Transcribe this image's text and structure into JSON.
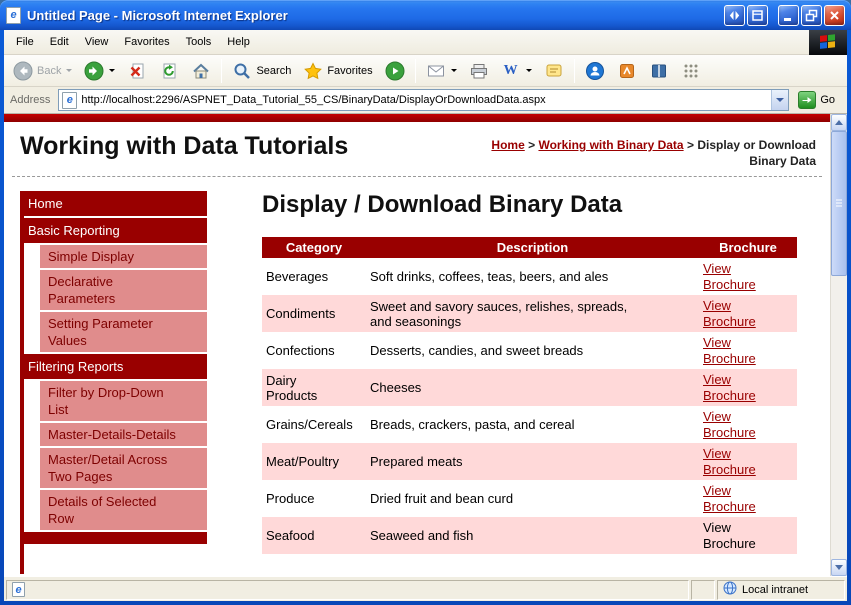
{
  "window": {
    "title": "Untitled Page - Microsoft Internet Explorer"
  },
  "menu": {
    "items": [
      {
        "label": "File"
      },
      {
        "label": "Edit"
      },
      {
        "label": "View"
      },
      {
        "label": "Favorites"
      },
      {
        "label": "Tools"
      },
      {
        "label": "Help"
      }
    ]
  },
  "toolbar": {
    "back_label": "Back",
    "search_label": "Search",
    "favorites_label": "Favorites"
  },
  "address": {
    "label": "Address",
    "value": "http://localhost:2296/ASPNET_Data_Tutorial_55_CS/BinaryData/DisplayOrDownloadData.aspx",
    "go_label": "Go"
  },
  "page": {
    "site_title": "Working with Data Tutorials",
    "breadcrumb": {
      "links": [
        {
          "label": "Home"
        },
        {
          "label": "Working with Binary Data"
        }
      ],
      "separator": ">",
      "current": "Display or Download Binary Data"
    },
    "heading": "Display / Download Binary Data",
    "sidebar": {
      "items": [
        {
          "label": "Home",
          "level": "section"
        },
        {
          "label": "Basic Reporting",
          "level": "section"
        },
        {
          "label": "Simple Display",
          "level": "item"
        },
        {
          "label": "Declarative Parameters",
          "level": "item"
        },
        {
          "label": "Setting Parameter Values",
          "level": "item"
        },
        {
          "label": "Filtering Reports",
          "level": "section"
        },
        {
          "label": "Filter by Drop-Down List",
          "level": "item"
        },
        {
          "label": "Master-Details-Details",
          "level": "item"
        },
        {
          "label": "Master/Detail Across Two Pages",
          "level": "item"
        },
        {
          "label": "Details of Selected Row",
          "level": "item"
        }
      ]
    },
    "table": {
      "headers": [
        "Category",
        "Description",
        "Brochure"
      ],
      "rows": [
        {
          "category": "Beverages",
          "description": "Soft drinks, coffees, teas, beers, and ales",
          "brochure": "View Brochure",
          "link": true
        },
        {
          "category": "Condiments",
          "description": "Sweet and savory sauces, relishes, spreads, and seasonings",
          "brochure": "View Brochure",
          "link": true
        },
        {
          "category": "Confections",
          "description": "Desserts, candies, and sweet breads",
          "brochure": "View Brochure",
          "link": true
        },
        {
          "category": "Dairy Products",
          "description": "Cheeses",
          "brochure": "View Brochure",
          "link": true
        },
        {
          "category": "Grains/Cereals",
          "description": "Breads, crackers, pasta, and cereal",
          "brochure": "View Brochure",
          "link": true
        },
        {
          "category": "Meat/Poultry",
          "description": "Prepared meats",
          "brochure": "View Brochure",
          "link": true
        },
        {
          "category": "Produce",
          "description": "Dried fruit and bean curd",
          "brochure": "View Brochure",
          "link": true
        },
        {
          "category": "Seafood",
          "description": "Seaweed and fish",
          "brochure": "View Brochure",
          "link": false
        }
      ]
    }
  },
  "statusbar": {
    "status_text": "",
    "zone": "Local intranet"
  },
  "colors": {
    "maroon": "#990000",
    "sidebar_pink": "#e08c8c",
    "row_pink": "#ffd9d9",
    "link": "#990000",
    "titlebar_blue": "#2676ef"
  },
  "icons": {
    "ie_glyph": "e",
    "edit_glyph": "W",
    "window_icon": "ie-page-icon",
    "back": "circle-arrow-left",
    "forward": "circle-arrow-right",
    "stop": "stop-x-document",
    "refresh": "refresh-arrows-document",
    "home": "house",
    "search": "magnifier",
    "favorites": "star",
    "media": "media-green-circle",
    "mail": "envelope",
    "print": "printer",
    "edit": "word-w",
    "discuss": "discuss-note",
    "throbber": "windows-flag",
    "go": "green-go-arrow",
    "status_document": "document-page",
    "status_zone": "globe"
  }
}
